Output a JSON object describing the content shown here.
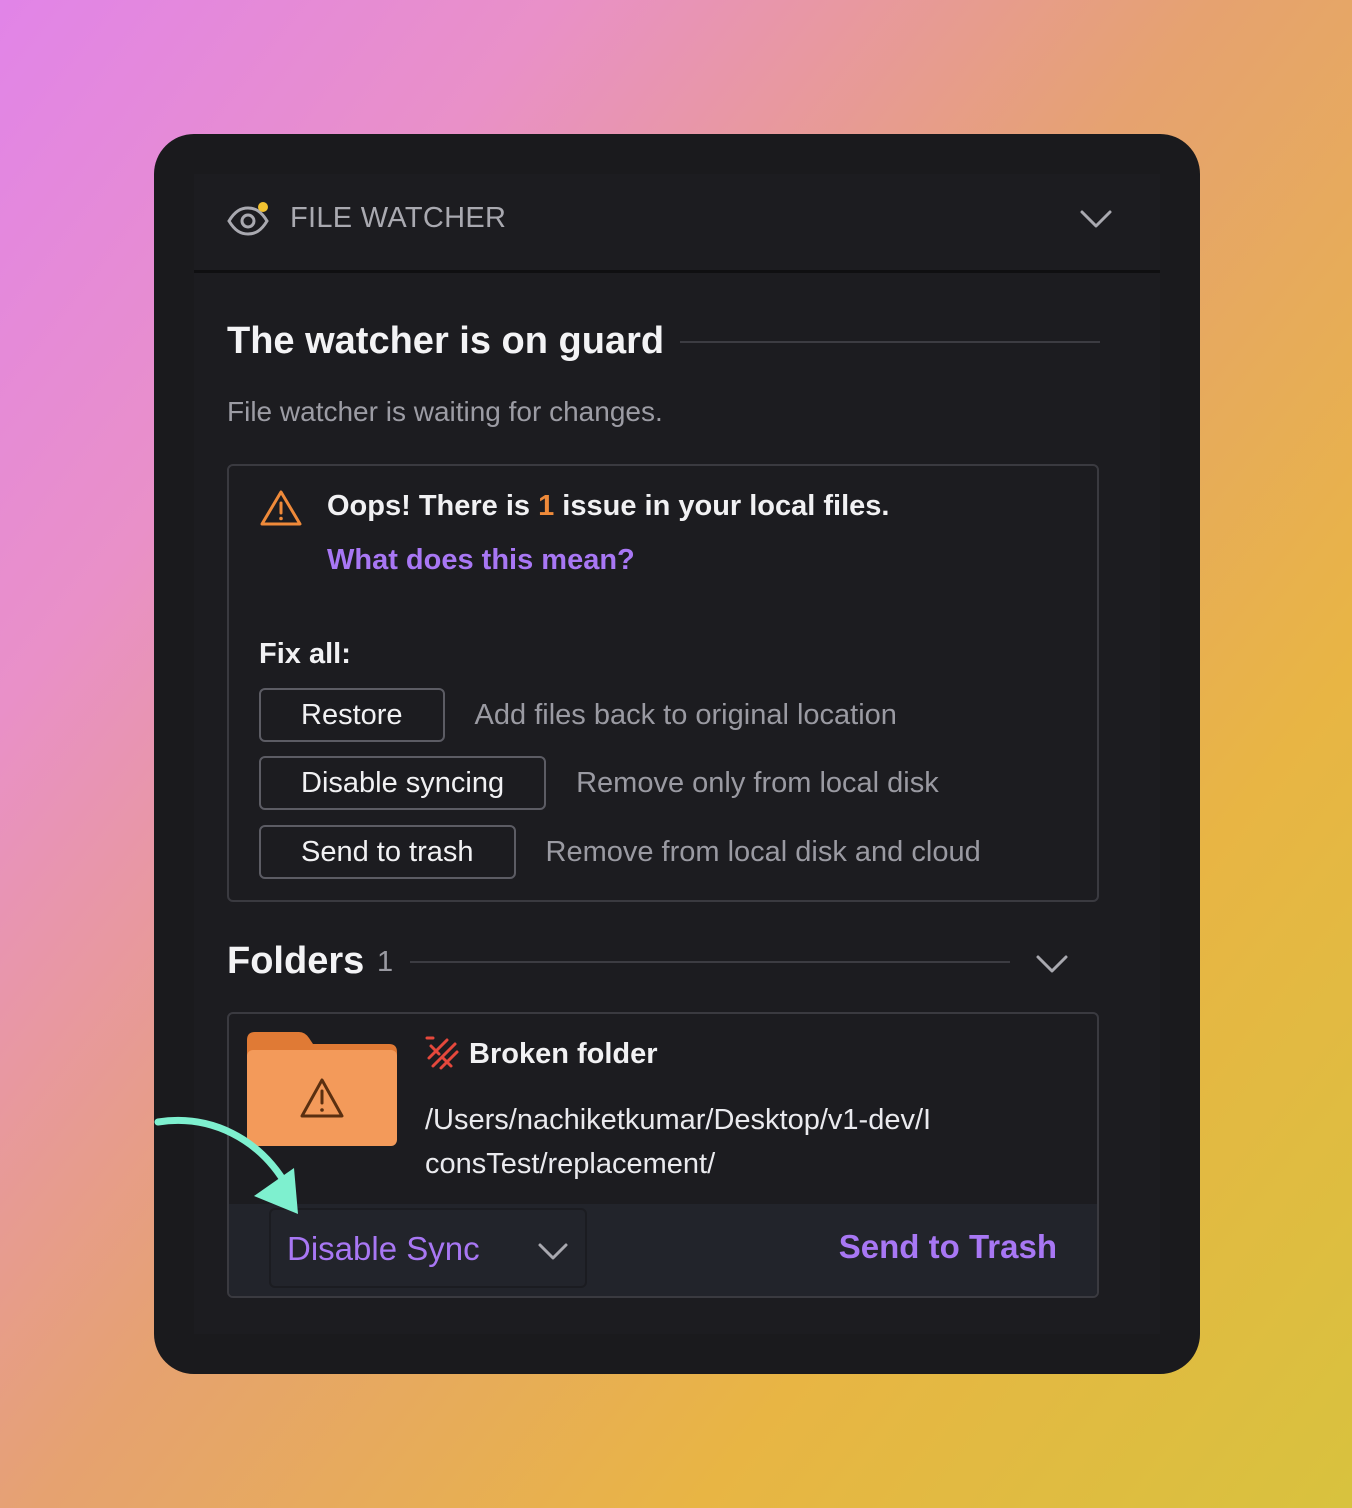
{
  "header": {
    "title": "FILE WATCHER",
    "icon": "eye-icon"
  },
  "status": {
    "title": "The watcher is on guard",
    "subtitle": "File watcher is waiting for changes."
  },
  "issue": {
    "prefix": "Oops! There is ",
    "count": "1",
    "suffix": " issue in your local files.",
    "help_link": "What does this mean?",
    "fix_all_label": "Fix all:",
    "actions": [
      {
        "label": "Restore",
        "description": "Add files back to original location"
      },
      {
        "label": "Disable syncing",
        "description": "Remove only from local disk"
      },
      {
        "label": "Send to trash",
        "description": "Remove from local disk and cloud"
      }
    ]
  },
  "folders": {
    "title": "Folders",
    "count": "1",
    "items": [
      {
        "name": "Broken folder",
        "path": "/Users/nachiketkumar/Desktop/v1-dev/IconsTest/replacement/",
        "primary_action": "Disable Sync",
        "secondary_action": "Send to Trash"
      }
    ]
  },
  "colors": {
    "accent": "#a877f4",
    "warning": "#ef8a3a",
    "folder": "#f39a5a",
    "arrow": "#7ef0cf",
    "panel": "#1a1a1d"
  }
}
